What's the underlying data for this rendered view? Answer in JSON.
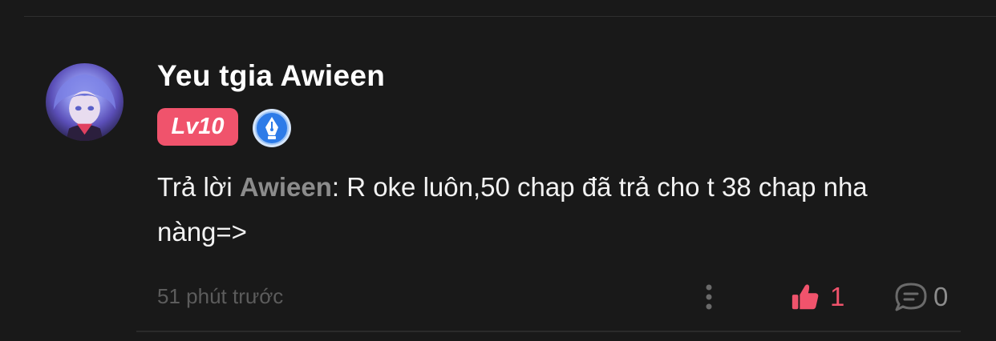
{
  "comment": {
    "username": "Yeu tgia Awieen",
    "level_badge": "Lv10",
    "reply_prefix": "Trả lời",
    "mention": "Awieen",
    "text_after_mention": ": R oke luôn,50 chap đã trả cho t 38 chap nha nàng=>",
    "timestamp": "51 phút trước",
    "like_count": "1",
    "reply_count": "0"
  },
  "colors": {
    "background": "#191919",
    "accent": "#f0536c",
    "mention": "#8c8c8c",
    "badge_blue": "#2d7be8"
  },
  "icons": {
    "avatar": "anime-avatar",
    "writer_badge": "fountain-pen-badge-icon",
    "more": "more-vertical-icon",
    "like": "thumbs-up-icon",
    "reply": "comment-bubble-icon"
  }
}
